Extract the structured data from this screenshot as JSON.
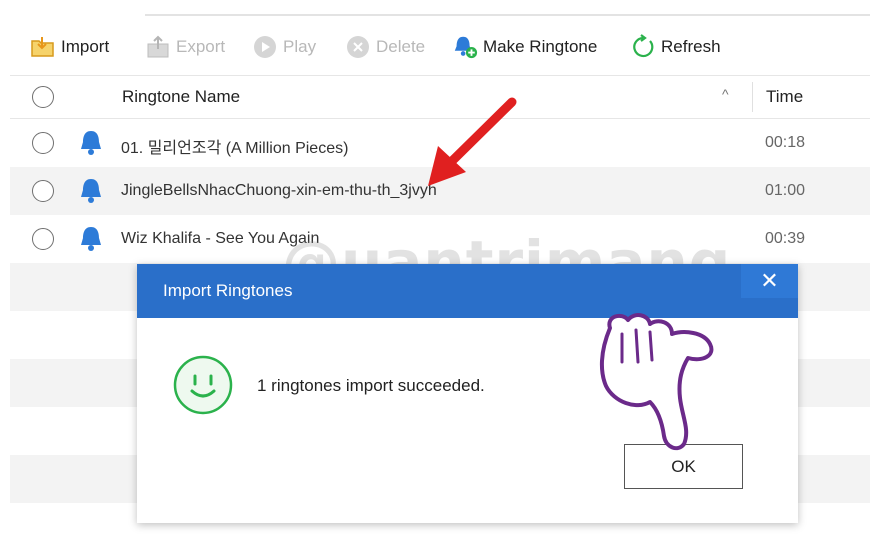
{
  "toolbar": {
    "import_label": "Import",
    "export_label": "Export",
    "play_label": "Play",
    "delete_label": "Delete",
    "make_ringtone_label": "Make Ringtone",
    "refresh_label": "Refresh"
  },
  "table": {
    "header": {
      "name": "Ringtone Name",
      "time": "Time",
      "sort_glyph": "^"
    },
    "rows": [
      {
        "name": "01. 밀리언조각 (A Million Pieces)",
        "time": "00:18"
      },
      {
        "name": "JingleBellsNhacChuong-xin-em-thu-th_3jvyh",
        "time": "01:00"
      },
      {
        "name": "Wiz Khalifa - See You Again",
        "time": "00:39"
      }
    ]
  },
  "watermark": {
    "text": "@uantrimang"
  },
  "dialog": {
    "title": "Import Ringtones",
    "close_glyph": "✕",
    "message": "1 ringtones import succeeded.",
    "ok_label": "OK"
  },
  "colors": {
    "dialog_header": "#2a6fc9",
    "accent_green": "#2bb24c",
    "bell_blue": "#2d7bd8",
    "arrow_red": "#e02020",
    "hand_purple": "#6b2a8a"
  }
}
